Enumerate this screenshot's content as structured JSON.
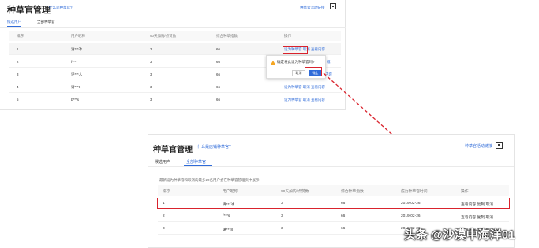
{
  "panel1": {
    "title": "种草官管理",
    "help_link": "什么是种草官?",
    "guide_link": "种草官活动链接",
    "tabs": [
      {
        "label": "候选用户",
        "active": true
      },
      {
        "label": "全部种草官",
        "active": false
      }
    ],
    "columns": [
      "排序",
      "用户昵称",
      "90天加购/点赞数",
      "综合种草指数",
      "操作"
    ],
    "rows": [
      {
        "rank": "1",
        "user": "清***冰",
        "count": "3",
        "index": "66",
        "actions": "设为种草官  取消  查看内容"
      },
      {
        "rank": "2",
        "user": "f***",
        "count": "3",
        "index": "66",
        "actions": "邀"
      },
      {
        "rank": "3",
        "user": "评***人",
        "count": "3",
        "index": "66",
        "actions": "内容"
      },
      {
        "rank": "4",
        "user": "请***8",
        "count": "3",
        "index": "66",
        "actions": "设为种草官  取消  查看内容"
      },
      {
        "rank": "5",
        "user": "b***s",
        "count": "3",
        "index": "66",
        "actions": "设为种草官  取消  查看内容"
      }
    ],
    "popconfirm": {
      "text": "确定将此设为种草官吗?",
      "cancel": "取消",
      "ok": "确定"
    }
  },
  "panel2": {
    "title": "种草官管理",
    "help_link": "什么是店铺种草官?",
    "guide_link": "种草官活动链接",
    "tabs": [
      {
        "label": "候选用户",
        "active": false
      },
      {
        "label": "全部种草官",
        "active": true
      }
    ],
    "note": "最新设为种草官和取消的最多20名用户会在种草官管理页中展示",
    "columns": [
      "排序",
      "用户昵称",
      "90天加购/点赞数",
      "综合种草指数",
      "成为种草官时间",
      "操作"
    ],
    "rows": [
      {
        "rank": "1",
        "user": "清***冰",
        "count": "3",
        "index": "66",
        "date": "2019-02-26",
        "actions": "查看内容  复制  取消"
      },
      {
        "rank": "2",
        "user": "f***s",
        "count": "3",
        "index": "66",
        "date": "2019-02-26",
        "actions": "查看内容  复制  取消"
      },
      {
        "rank": "3",
        "user": "请***8",
        "count": "3",
        "index": "66",
        "date": "2019-02-26",
        "actions": "查看内容  复制  取消"
      }
    ]
  },
  "watermark": "头条 @沙漠中海洋01",
  "colors": {
    "accent": "#2f6bd9",
    "highlight": "#d9232d",
    "warning": "#f5a623"
  }
}
